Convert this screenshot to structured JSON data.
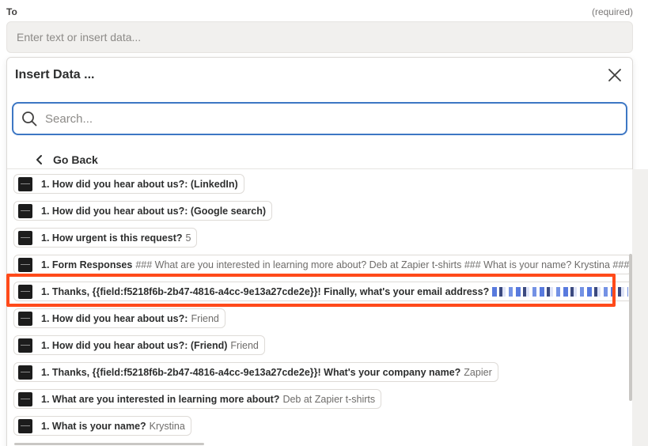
{
  "field": {
    "label": "To",
    "required_text": "(required)",
    "placeholder": "Enter text or insert data..."
  },
  "dropdown": {
    "title": "Insert Data ...",
    "close_icon": "close-icon",
    "search_placeholder": "Search...",
    "search_icon": "search-icon",
    "go_back_label": "Go Back",
    "items": [
      {
        "key": "1. How did you hear about us?: (LinkedIn)",
        "value": ""
      },
      {
        "key": "1. How did you hear about us?: (Google search)",
        "value": ""
      },
      {
        "key": "1. How urgent is this request?",
        "value": "5"
      },
      {
        "key": "1. Form Responses",
        "value": "### What are you interested in learning more about? Deb at Zapier t-shirts ### What is your name? Krystina ###"
      },
      {
        "key": "1. Thanks, {{field:f5218f6b-2b47-4816-a4cc-9e13a27cde2e}}! Finally, what's your email address?",
        "value": "",
        "redacted": true
      },
      {
        "key": "1. How did you hear about us?:",
        "value": "Friend"
      },
      {
        "key": "1. How did you hear about us?: (Friend)",
        "value": "Friend"
      },
      {
        "key": "1. Thanks, {{field:f5218f6b-2b47-4816-a4cc-9e13a27cde2e}}! What's your company name?",
        "value": "Zapier"
      },
      {
        "key": "1. What are you interested in learning more about?",
        "value": "Deb at Zapier t-shirts"
      },
      {
        "key": "1. What is your name?",
        "value": "Krystina"
      }
    ]
  },
  "colors": {
    "highlight": "#ff4a1a",
    "search_border": "#3d77c4"
  }
}
